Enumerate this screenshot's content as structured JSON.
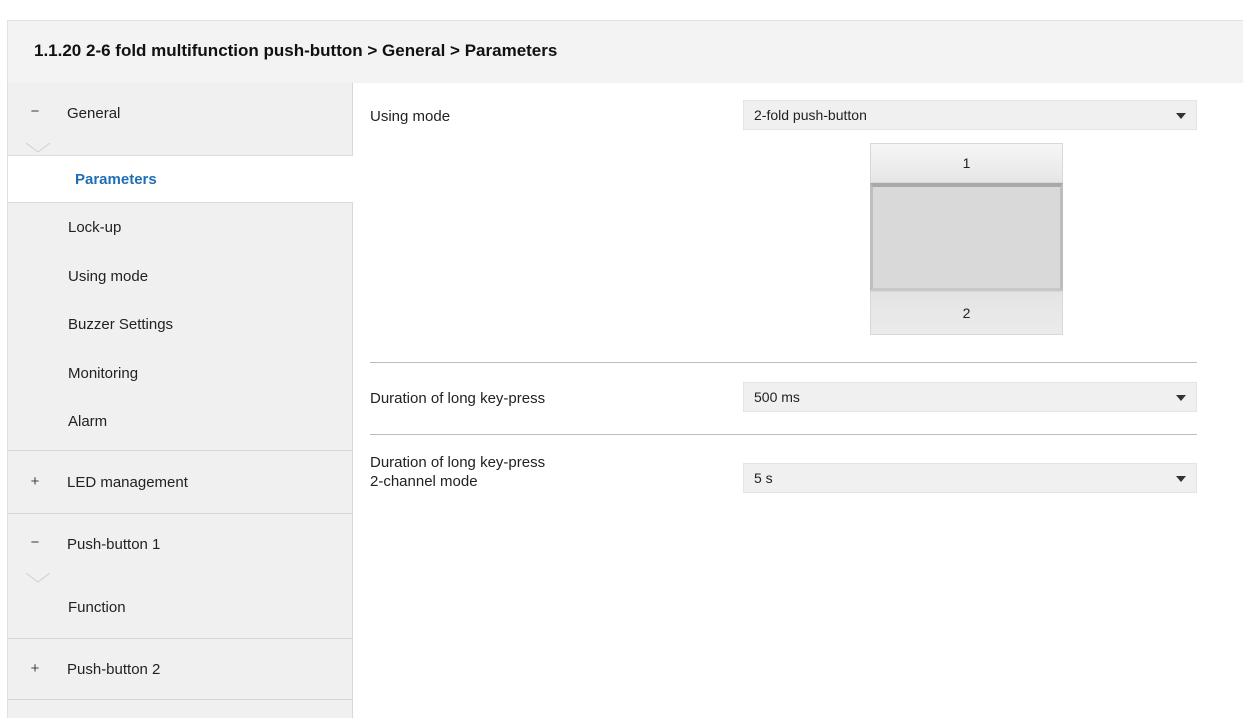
{
  "header": {
    "title": "1.1.20 2-6 fold multifunction push-button > General > Parameters"
  },
  "sidebar": {
    "groups": [
      {
        "sign": "−",
        "label": "General",
        "expanded": true
      },
      {
        "sign": "+",
        "label": "LED management",
        "expanded": false
      },
      {
        "sign": "−",
        "label": "Push-button 1",
        "expanded": true
      },
      {
        "sign": "+",
        "label": "Push-button 2",
        "expanded": false
      }
    ],
    "general_items": [
      "Parameters",
      "Lock-up",
      "Using mode",
      "Buzzer Settings",
      "Monitoring",
      "Alarm"
    ],
    "push_button_1_items": [
      "Function"
    ],
    "active_item": "Parameters"
  },
  "params": {
    "using_mode": {
      "label": "Using mode",
      "value": "2-fold push-button"
    },
    "long_press": {
      "label": "Duration of long key-press",
      "value": "500 ms"
    },
    "long_press_2ch": {
      "label_line1": "Duration of long key-press",
      "label_line2": "2-channel mode",
      "value": "5 s"
    }
  },
  "diagram": {
    "top_number": "1",
    "bottom_number": "2"
  },
  "colors": {
    "active_text": "#1f6fb5",
    "sidebar_bg": "#f0f0f0",
    "header_bg": "#f3f3f3"
  }
}
